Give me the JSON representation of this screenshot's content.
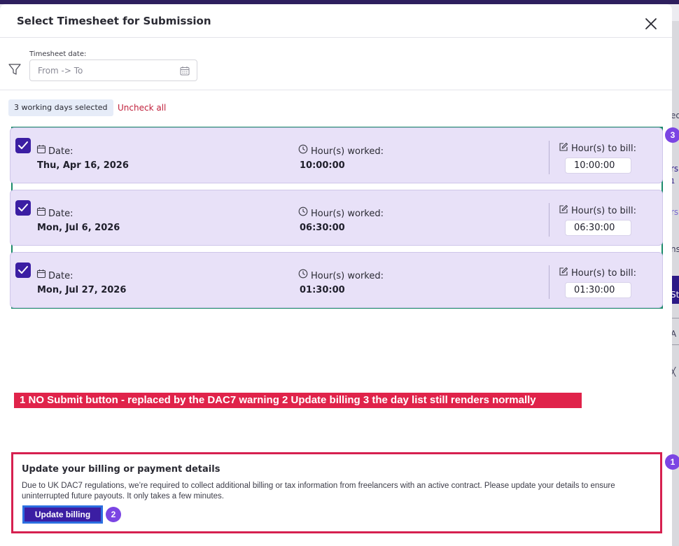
{
  "modal": {
    "title": "Select Timesheet for Submission"
  },
  "filter": {
    "label": "Timesheet date:",
    "placeholder": "From -> To"
  },
  "selection": {
    "badge": "3 working days selected",
    "uncheck_all": "Uncheck all"
  },
  "days": [
    {
      "date_label": "Date:",
      "date": "Thu, Apr 16, 2026",
      "worked_label": "Hour(s) worked:",
      "worked": "10:00:00",
      "bill_label": "Hour(s) to bill:",
      "bill": "10:00:00",
      "checked": true
    },
    {
      "date_label": "Date:",
      "date": "Mon, Jul 6, 2026",
      "worked_label": "Hour(s) worked:",
      "worked": "06:30:00",
      "bill_label": "Hour(s) to bill:",
      "bill": "06:30:00",
      "checked": true
    },
    {
      "date_label": "Date:",
      "date": "Mon, Jul 27, 2026",
      "worked_label": "Hour(s) worked:",
      "worked": "01:30:00",
      "bill_label": "Hour(s) to bill:",
      "bill": "01:30:00",
      "checked": true
    }
  ],
  "annotation_caption": "1 NO Submit button - replaced by the DAC7 warning   2 Update billing   3 the day list still renders normally",
  "notice": {
    "title": "Update your billing or payment details",
    "body": "Due to UK DAC7 regulations, we’re required to collect additional billing or tax information from freelancers with an active contract. Please update your details to ensure uninterrupted future payouts. It only takes a few minutes.",
    "button": "Update billing"
  },
  "markers": {
    "m1": "1",
    "m2": "2",
    "m3": "3"
  },
  "background_fragments": [
    "ed",
    "rs",
    "1",
    "rs",
    "ns",
    "St",
    "A",
    "╳"
  ],
  "colors": {
    "accent": "#3b1ea3",
    "card": "#e8e1f8",
    "warning_border": "#d62050",
    "list_outline": "#1a8a6a",
    "marker": "#7b45e3",
    "link": "#c01f3a"
  }
}
